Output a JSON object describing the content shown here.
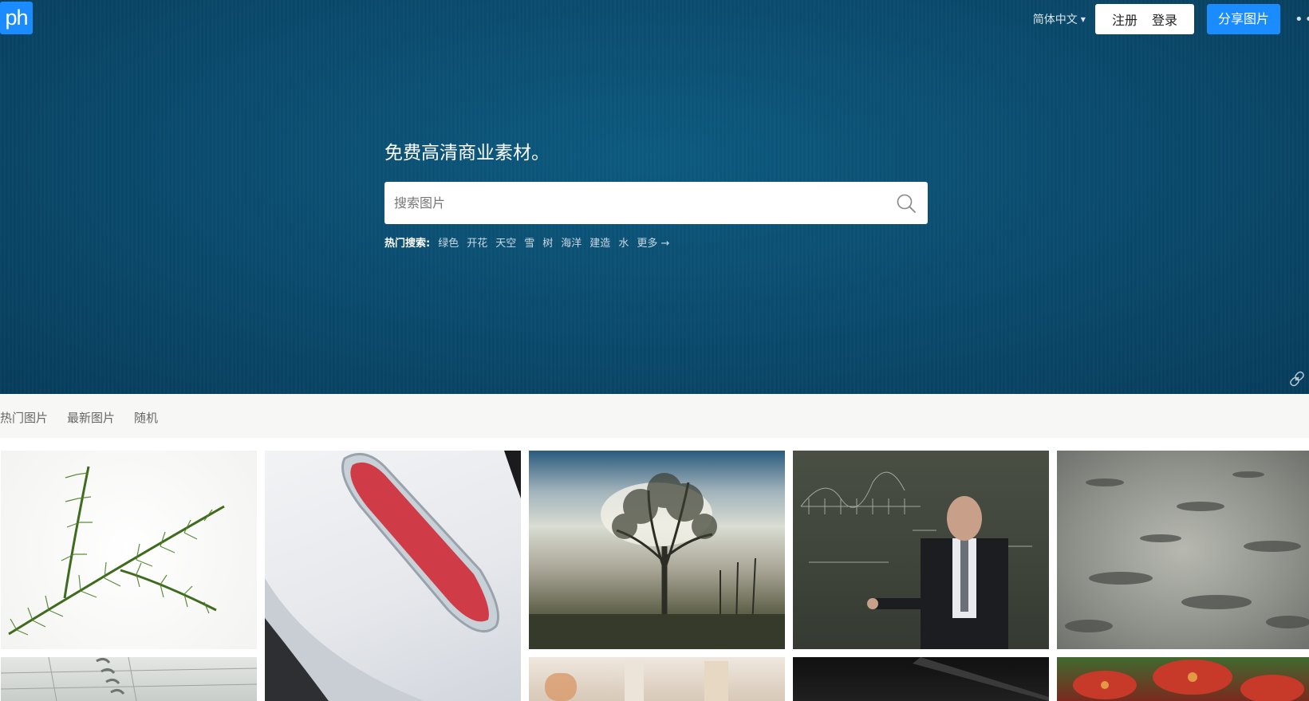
{
  "logo": {
    "text": "ph"
  },
  "header": {
    "language": "简体中文",
    "register_label": "注册",
    "login_label": "登录",
    "share_label": "分享图片"
  },
  "hero": {
    "tagline": "免费高清商业素材。",
    "search_placeholder": "搜索图片",
    "hot_label": "热门搜索:",
    "hot_tags": [
      "绿色",
      "开花",
      "天空",
      "雪",
      "树",
      "海洋",
      "建造",
      "水",
      "更多 →"
    ]
  },
  "filters": [
    "热门图片",
    "最新图片",
    "随机"
  ],
  "colors": {
    "accent": "#1a8cff",
    "hero_bg": "#0b4d70"
  },
  "icons": {
    "search": "search-icon",
    "more": "more-dots-icon",
    "link": "link-icon"
  }
}
